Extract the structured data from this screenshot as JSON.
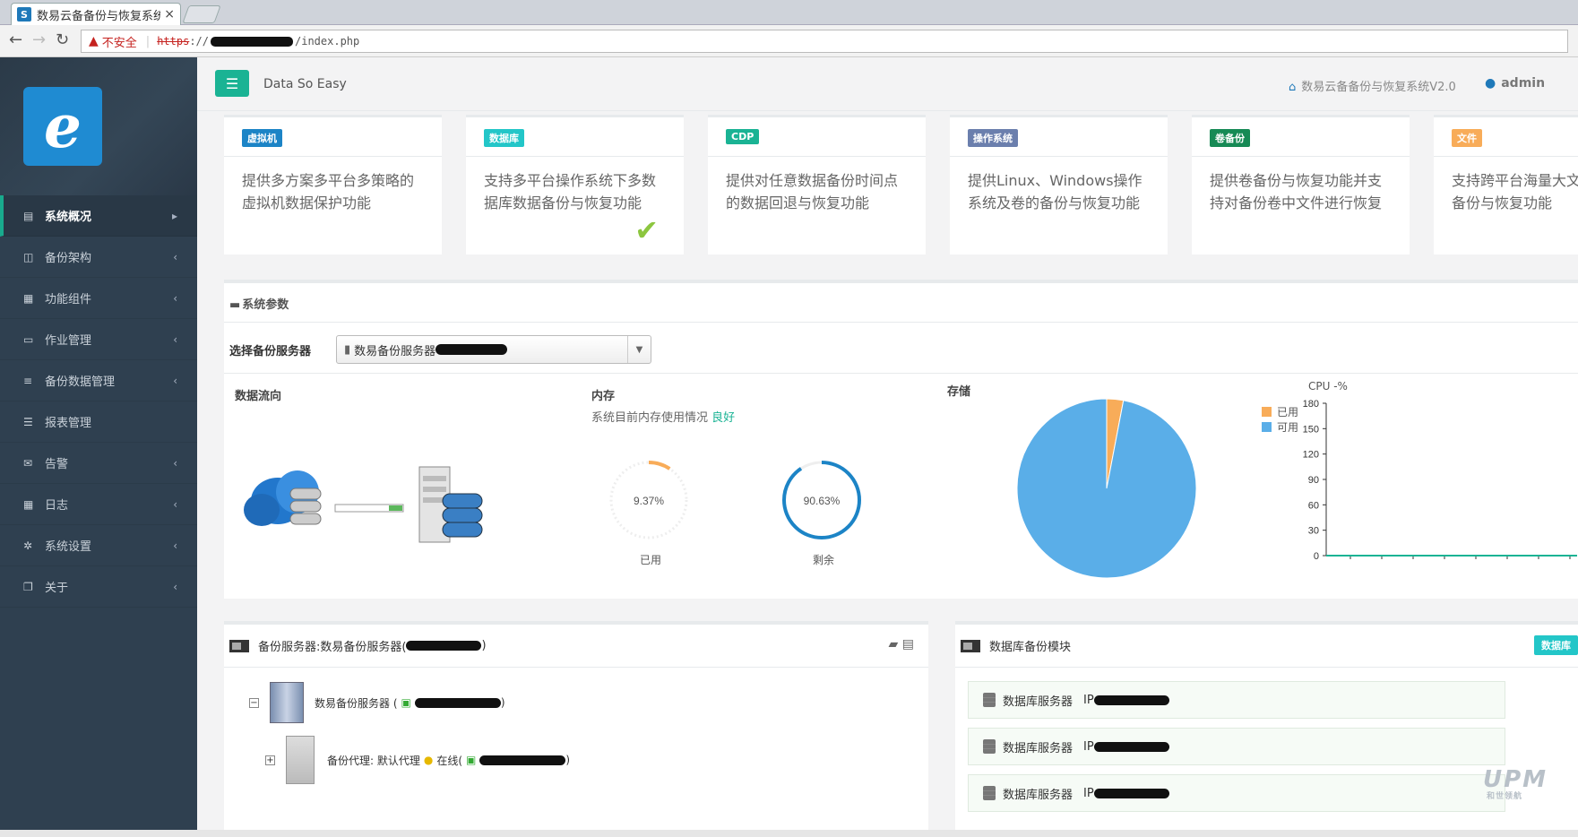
{
  "browser": {
    "tab_title": "数易云备备份与恢复系统",
    "tab_close": "×",
    "favicon_letter": "S",
    "insecure_label": "不安全",
    "url_scheme": "https",
    "url_sep": "://",
    "url_path": "/index.php"
  },
  "sidebar": {
    "logo_letter": "e",
    "items": [
      {
        "label": "系统概况",
        "icon": "home-icon",
        "glyph": "▤",
        "chev": "▸",
        "active": true
      },
      {
        "label": "备份架构",
        "icon": "columns-icon",
        "glyph": "◫",
        "chev": "‹"
      },
      {
        "label": "功能组件",
        "icon": "chart-icon",
        "glyph": "▦",
        "chev": "‹"
      },
      {
        "label": "作业管理",
        "icon": "desktop-icon",
        "glyph": "▭",
        "chev": "‹"
      },
      {
        "label": "备份数据管理",
        "icon": "database-icon",
        "glyph": "≡",
        "chev": "‹"
      },
      {
        "label": "报表管理",
        "icon": "list-icon",
        "glyph": "☰",
        "chev": ""
      },
      {
        "label": "告警",
        "icon": "envelope-icon",
        "glyph": "✉",
        "chev": "‹"
      },
      {
        "label": "日志",
        "icon": "table-icon",
        "glyph": "▦",
        "chev": "‹"
      },
      {
        "label": "系统设置",
        "icon": "gear-icon",
        "glyph": "✲",
        "chev": "‹"
      },
      {
        "label": "关于",
        "icon": "copy-icon",
        "glyph": "❐",
        "chev": "‹"
      }
    ]
  },
  "header": {
    "menu_glyph": "☰",
    "slogan": "Data So Easy",
    "system_name": "数易云备备份与恢复系统V2.0",
    "user": "admin"
  },
  "cards": [
    {
      "badge": "虚拟机",
      "color": "#1c84c6",
      "text": "提供多方案多平台多策略的虚拟机数据保护功能"
    },
    {
      "badge": "数据库",
      "color": "#23c6c8",
      "text": "支持多平台操作系统下多数据库数据备份与恢复功能",
      "check": true
    },
    {
      "badge": "CDP",
      "color": "#1ab394",
      "text": "提供对任意数据备份时间点的数据回退与恢复功能"
    },
    {
      "badge": "操作系统",
      "color": "#6b7fad",
      "text": "提供Linux、Windows操作系统及卷的备份与恢复功能"
    },
    {
      "badge": "卷备份",
      "color": "#168a55",
      "text": "提供卷备份与恢复功能并支持对备份卷中文件进行恢复"
    },
    {
      "badge": "文件",
      "color": "#f8ac59",
      "text": "支持跨平台海量大文件定时备份与恢复功能"
    }
  ],
  "params": {
    "title": "系统参数",
    "select_label": "选择备份服务器",
    "select_value": "数易备份服务器",
    "dataflow_title": "数据流向",
    "memory_title": "内存",
    "memory_desc": "系统目前内存使用情况",
    "memory_status": "良好",
    "used_label": "已用",
    "free_label": "剩余",
    "storage_title": "存储",
    "cpu_title": "CPU -%",
    "legend": [
      {
        "label": "已用",
        "color": "#f8ac59"
      },
      {
        "label": "可用",
        "color": "#5aaee8"
      }
    ]
  },
  "chart_data": [
    {
      "type": "gauge",
      "title": "内存",
      "series": [
        {
          "name": "已用",
          "value": 9.37,
          "display": "9.37%",
          "color": "#f8ac59"
        },
        {
          "name": "剩余",
          "value": 90.63,
          "display": "90.63%",
          "color": "#1c84c6"
        }
      ]
    },
    {
      "type": "pie",
      "title": "存储",
      "series": [
        {
          "name": "已用",
          "value": 3,
          "color": "#f8ac59"
        },
        {
          "name": "可用",
          "value": 97,
          "color": "#5aaee8"
        }
      ]
    },
    {
      "type": "line",
      "title": "CPU -%",
      "yticks": [
        "180",
        "150",
        "120",
        "90",
        "60",
        "30",
        "0"
      ],
      "ylim": [
        0,
        180
      ],
      "series": [
        {
          "values": [
            0,
            0,
            0,
            0,
            0,
            0,
            0,
            0,
            0
          ],
          "color": "#1ab394"
        }
      ]
    }
  ],
  "backup_panel": {
    "title": "备份服务器:数易备份服务器(",
    "title_end": ")",
    "root_label": "数易备份服务器 (",
    "root_end": ")",
    "agent_label": "备份代理: 默认代理",
    "agent_status": "在线(",
    "agent_end": ")",
    "collapse": "−",
    "expand": "+"
  },
  "db_panel": {
    "title": "数据库备份模块",
    "badge": "数据库",
    "rows": [
      {
        "label": "数据库服务器",
        "ip_label": "IP"
      },
      {
        "label": "数据库服务器",
        "ip_label": "IP"
      },
      {
        "label": "数据库服务器",
        "ip_label": "IP"
      }
    ]
  },
  "watermark": {
    "brand": "UPM",
    "sub": "和世领航"
  }
}
